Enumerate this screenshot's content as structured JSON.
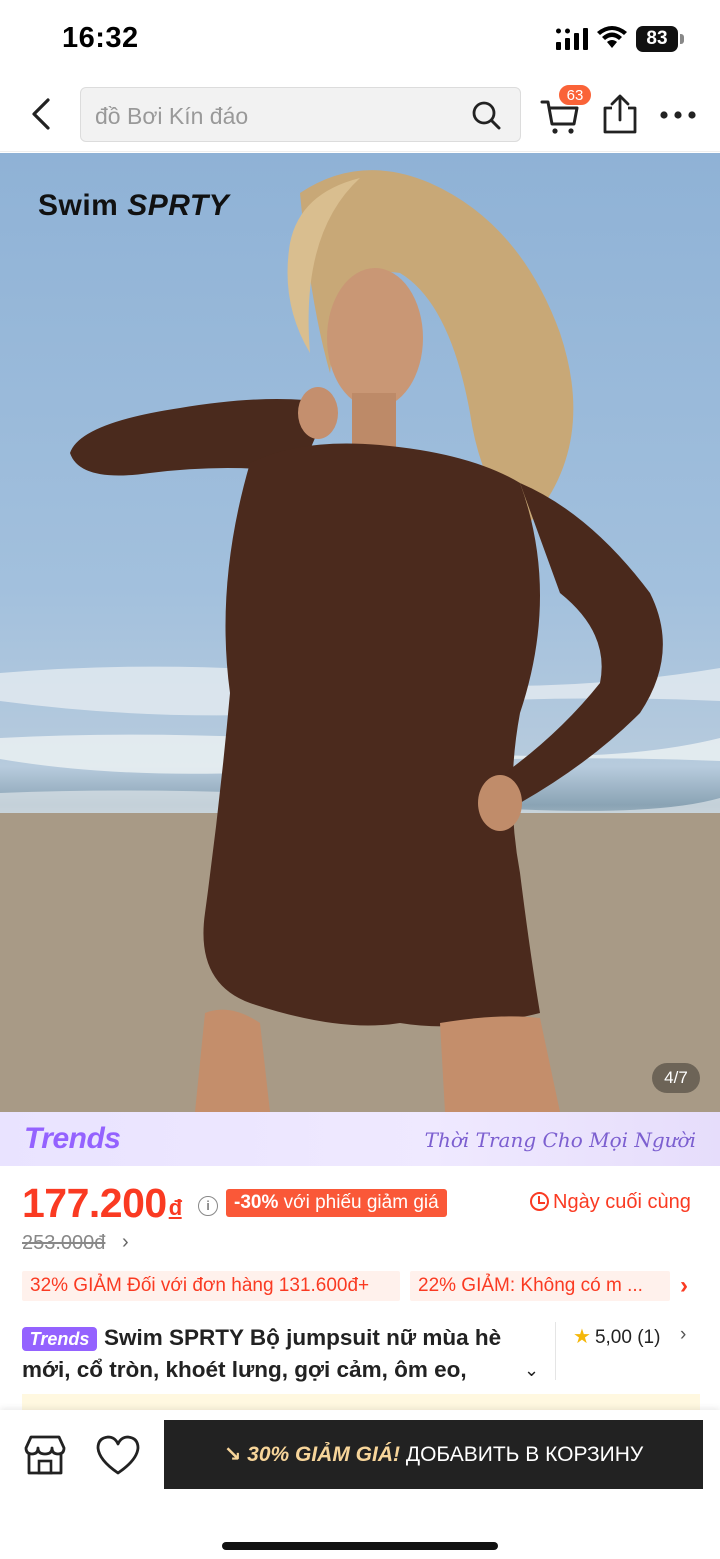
{
  "status_bar": {
    "time": "16:32",
    "battery": "83"
  },
  "header": {
    "search_placeholder": "đồ Bơi Kín đáo",
    "cart_count": "63",
    "icons": [
      "back-arrow-icon",
      "search-icon",
      "cart-icon",
      "share-icon",
      "more-icon"
    ]
  },
  "gallery": {
    "brand_watermark_prefix": "Swim ",
    "brand_watermark_suffix": "SPRTY",
    "counter": "4/7"
  },
  "trends_banner": {
    "logo": "Trends",
    "slogan": "Thời Trang Cho Mọi Người"
  },
  "price": {
    "current": "177.200",
    "currency": "đ",
    "discount_percent": "-30%",
    "discount_text": " với phiếu giảm giá",
    "deadline": "Ngày cuối cùng",
    "original": "253.000đ"
  },
  "coupons": [
    {
      "text": "32% GIẢM Đối với đơn hàng 131.600đ+"
    },
    {
      "text": "22% GIẢM: Không có m ..."
    }
  ],
  "product": {
    "badge": "Trends",
    "title": "Swim SPRTY Bộ jumpsuit nữ mùa hè mới, cổ tròn, khoét lưng, gợi cảm, ôm eo,",
    "rating": "5,00 (1)"
  },
  "bottom_bar": {
    "promo": "30% GIẢM GIÁ!",
    "add_to_cart": "ДОБАВИТЬ В КОРЗИНУ"
  },
  "colors": {
    "price_red": "#fa3a22",
    "badge_orange": "#fa6338",
    "trends_purple": "#9462ff",
    "button_dark": "#222222",
    "promo_gold": "#f7d59a"
  }
}
